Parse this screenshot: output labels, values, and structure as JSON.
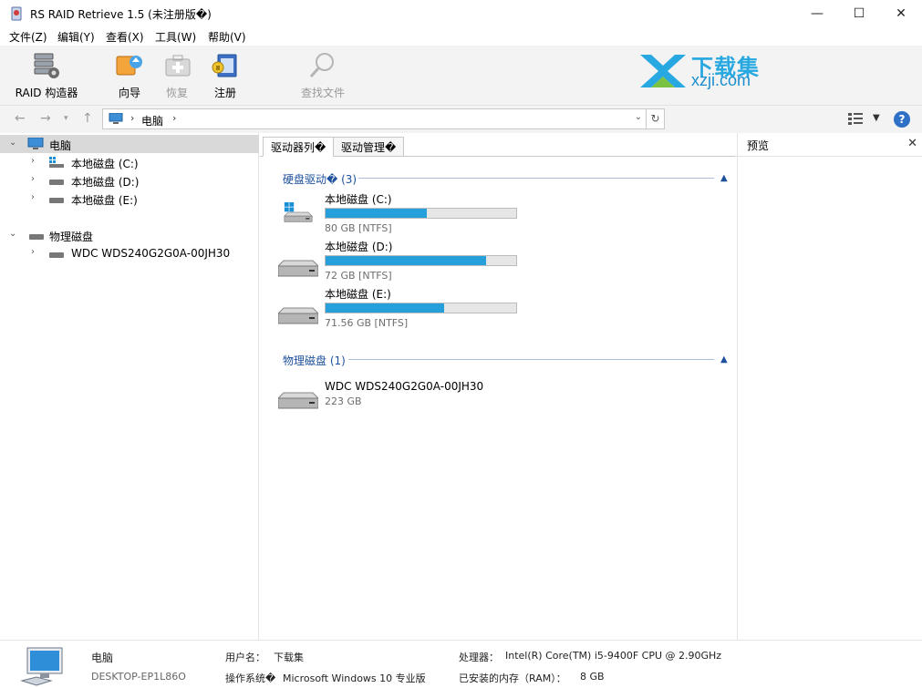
{
  "window": {
    "title": "RS RAID Retrieve 1.5 (未注册版�)",
    "minimize_glyph": "—",
    "maximize_glyph": "☐",
    "close_glyph": "✕"
  },
  "menu": [
    {
      "label": "文件(Z)"
    },
    {
      "label": "编辑(Y)"
    },
    {
      "label": "查看(X)"
    },
    {
      "label": "工具(W)"
    },
    {
      "label": "帮助(V)"
    }
  ],
  "toolbar": {
    "raid_builder": "RAID 构造器",
    "wizard": "向导",
    "recover": "恢复",
    "register": "注册",
    "find_file": "查找文件"
  },
  "watermark": {
    "text1": "下载集",
    "text2": "xzji.com"
  },
  "address": {
    "path": "电脑",
    "sep": "›"
  },
  "tree": {
    "root": "电脑",
    "volumes": [
      {
        "label": "本地磁盘 (C:)"
      },
      {
        "label": "本地磁盘 (D:)"
      },
      {
        "label": "本地磁盘 (E:)"
      }
    ],
    "physical_root": "物理磁盘",
    "physical": [
      {
        "label": "WDC WDS240G2G0A-00JH30"
      }
    ]
  },
  "tabs": [
    "驱动器列�",
    "驱动管理�"
  ],
  "hard_drives": {
    "header": "硬盘驱动� (3)",
    "items": [
      {
        "name": "本地磁盘 (C:)",
        "meta": "80 GB [NTFS]",
        "used": 0.53
      },
      {
        "name": "本地磁盘 (D:)",
        "meta": "72 GB [NTFS]",
        "used": 0.84
      },
      {
        "name": "本地磁盘 (E:)",
        "meta": "71.56 GB [NTFS]",
        "used": 0.62
      }
    ]
  },
  "physical_disks": {
    "header": "物理磁盘 (1)",
    "items": [
      {
        "name": "WDC WDS240G2G0A-00JH30",
        "meta": "223 GB"
      }
    ]
  },
  "preview": {
    "title": "预览",
    "close": "✕"
  },
  "status": {
    "computer": "电脑",
    "hostname": "DESKTOP-EP1L86O",
    "user_label": "用户名：",
    "user_value": "下载集",
    "os_label": "操作系统�",
    "os_value": "Microsoft Windows 10 专业版",
    "cpu_label": "处理器：",
    "cpu_value": "Intel(R) Core(TM) i5-9400F CPU @ 2.90GHz",
    "ram_label": "已安装的内存（RAM）：",
    "ram_value": "8 GB"
  },
  "colors": {
    "accent": "#26a0da",
    "section": "#1c4f9c"
  }
}
